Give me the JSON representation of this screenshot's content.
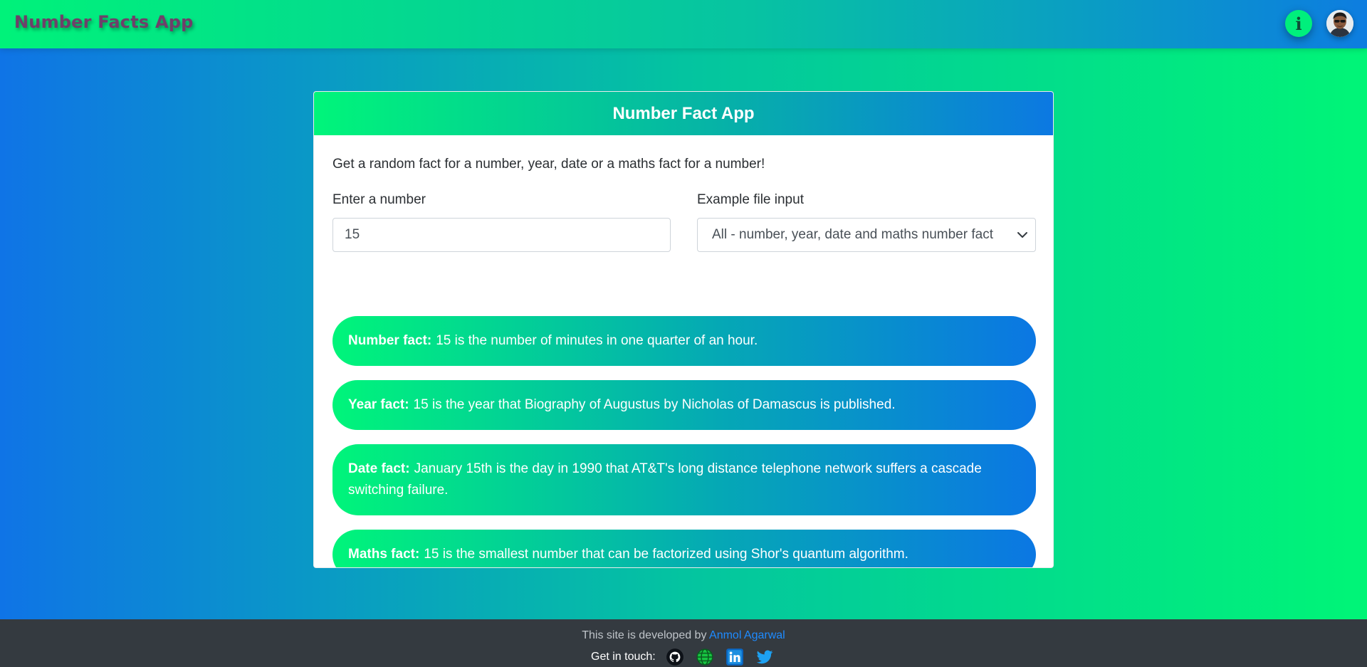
{
  "navbar": {
    "brand": "Number Facts App",
    "info_label": "i",
    "info_icon": "info-icon",
    "avatar_icon": "user-avatar"
  },
  "card": {
    "title": "Number Fact App",
    "intro": "Get a random fact for a number, year, date or a maths fact for a number!",
    "number_label": "Enter a number",
    "number_value": "15",
    "type_label": "Example file input",
    "type_selected": "All - number, year, date and maths number fact",
    "facts": [
      {
        "label": "Number fact:",
        "text": "15 is the number of minutes in one quarter of an hour."
      },
      {
        "label": "Year fact:",
        "text": "15 is the year that Biography of Augustus by Nicholas of Damascus is published."
      },
      {
        "label": "Date fact:",
        "text": "January 15th is the day in 1990 that AT&T's long distance telephone network suffers a cascade switching failure."
      },
      {
        "label": "Maths fact:",
        "text": "15 is the smallest number that can be factorized using Shor's quantum algorithm."
      }
    ]
  },
  "footer": {
    "dev_prefix": "This site is developed by",
    "dev_name": "Anmol Agarwal",
    "touch_label": "Get in touch:",
    "socials": [
      "github-icon",
      "globe-icon",
      "linkedin-icon",
      "twitter-icon"
    ]
  },
  "colors": {
    "brand_text": "#6f3f6a",
    "gradient_green": "#00f57a",
    "gradient_blue": "#0b77e3",
    "footer_bg": "#343a40",
    "link": "#1e8bff"
  }
}
